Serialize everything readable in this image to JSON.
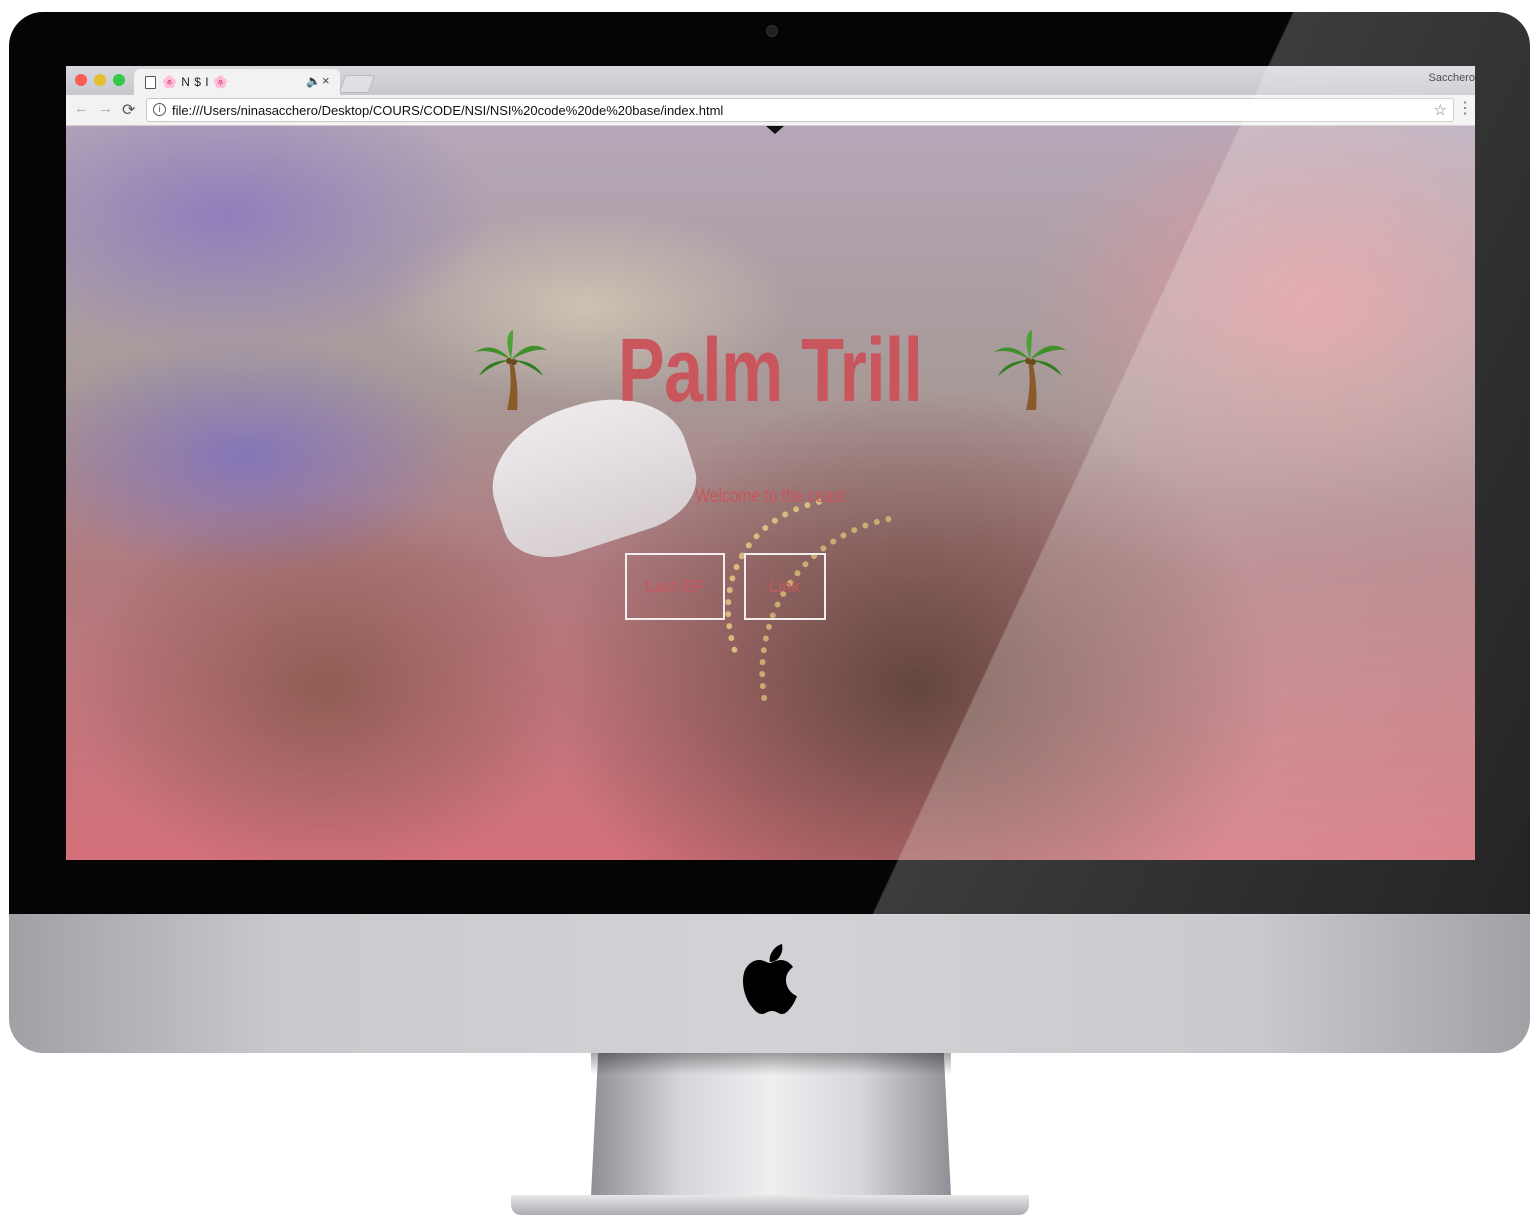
{
  "browser": {
    "tab_title": "🌸 N $ I 🌸",
    "profile_name": "Sacchero",
    "url": "file:///Users/ninasacchero/Desktop/COURS/CODE/NSI/NSI%20code%20de%20base/index.html",
    "icons": {
      "back": "←",
      "forward": "→",
      "reload": "⟳",
      "info": "i",
      "star": "☆",
      "menu": "⋮",
      "audio": "🔈",
      "close": "×"
    }
  },
  "hero": {
    "title": "Palm Trill",
    "subtitle": "Welcome to the coast",
    "buttons": {
      "last_ep": "Last EP",
      "link": "Link"
    }
  },
  "colors": {
    "accent": "#c9555d",
    "button_border": "#f2eef0"
  }
}
